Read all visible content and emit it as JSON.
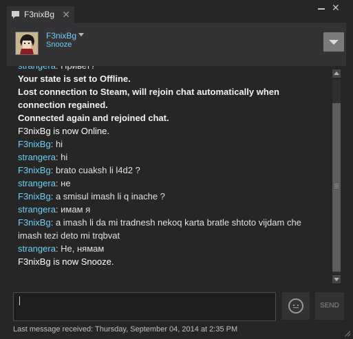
{
  "window": {
    "tab_title": "F3nixBg",
    "tab_close": "✕",
    "close_glyph": "✕"
  },
  "header": {
    "persona_name": "F3nixBg",
    "persona_status": "Snooze"
  },
  "messages": [
    {
      "type": "chat",
      "sender": "strangera",
      "own": false,
      "text": "Привет?"
    },
    {
      "type": "system",
      "text": "Your state is set to Offline."
    },
    {
      "type": "system",
      "text": "Lost connection to Steam, will rejoin chat automatically when connection regained."
    },
    {
      "type": "system",
      "text": "Connected again and rejoined chat."
    },
    {
      "type": "status",
      "text": "F3nixBg is now Online."
    },
    {
      "type": "chat",
      "sender": "F3nixBg",
      "own": true,
      "text": "hi"
    },
    {
      "type": "chat",
      "sender": "strangera",
      "own": false,
      "text": "hi"
    },
    {
      "type": "chat",
      "sender": "F3nixBg",
      "own": true,
      "text": "brato cuaksh li l4d2 ?"
    },
    {
      "type": "chat",
      "sender": "strangera",
      "own": false,
      "text": "не"
    },
    {
      "type": "chat",
      "sender": "F3nixBg",
      "own": true,
      "text": "a smisul imash li q inache ?"
    },
    {
      "type": "chat",
      "sender": "strangera",
      "own": false,
      "text": "имам я"
    },
    {
      "type": "chat",
      "sender": "F3nixBg",
      "own": true,
      "text": "a imash li da mi tradnesh nekoq karta bratle shtoto vijdam che imash tezi deto mi trqbvat"
    },
    {
      "type": "chat",
      "sender": "strangera",
      "own": false,
      "text": "Не, нямам"
    },
    {
      "type": "status",
      "text": "F3nixBg is now Snooze."
    }
  ],
  "composer": {
    "input_value": "",
    "send_label": "SEND"
  },
  "footer": {
    "last_message": "Last message received: Thursday, September 04, 2014 at 2:35 PM"
  },
  "colors": {
    "accent_blue": "#6dcff6",
    "background": "#262626",
    "panel": "#333335"
  },
  "icons": [
    "chat-icon",
    "close-icon",
    "minimize-icon",
    "avatar",
    "dropdown-icon",
    "menu-dropdown-icon",
    "emoticon-icon",
    "scroll-up-icon",
    "scroll-down-icon"
  ]
}
